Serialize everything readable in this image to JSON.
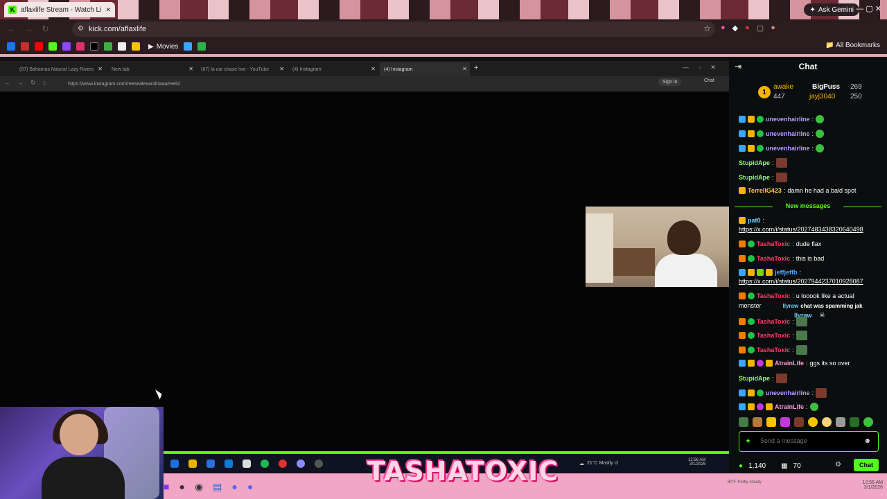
{
  "outer_browser": {
    "tab_title": "aflaxlife Stream - Watch Liv",
    "url": "kick.com/aflaxlife",
    "ask_gemini": "Ask Gemini",
    "bookmarks": {
      "movies": "Movies",
      "all": "All Bookmarks"
    }
  },
  "inner_browser": {
    "tabs": [
      {
        "label": "(67) Bahamas Natural Lazy Rivers"
      },
      {
        "label": "New tab"
      },
      {
        "label": "(67) la car chase live - YouTube"
      },
      {
        "label": "(4) Instagram"
      },
      {
        "label": "(4) Instagram"
      }
    ],
    "url": "https://www.instagram.com/reesealexandriaaa/reels/",
    "sign_in": "Sign in",
    "chat_btn": "Chat",
    "weather": "21°C  Mostly cl",
    "time": "12:56 AM",
    "date": "3/1/2026"
  },
  "overlay": {
    "name": "TASHATOXIC"
  },
  "outer_taskbar": {
    "weather": "80°F  Partly cloudy",
    "time": "12:56 AM",
    "date": "3/1/2026"
  },
  "chat": {
    "title": "Chat",
    "pinned": {
      "rank": "1",
      "user1": "awake",
      "user1_count": "447",
      "user2": "BigPuss",
      "user2_count": "269",
      "user3": "jayj3040",
      "user3_count": "250"
    },
    "messages": [
      {
        "user": "unevenhairline",
        "text": ""
      },
      {
        "user": "unevenhairline",
        "text": ""
      },
      {
        "user": "unevenhairline",
        "text": ""
      },
      {
        "user": "StupidApe",
        "text": ""
      },
      {
        "user": "StupidApe",
        "text": ""
      },
      {
        "user": "TerrellG423",
        "text": "damn he had a bald spot"
      },
      {
        "user": "pat0",
        "text": "https://x.com/i/status/2027483438320640498"
      },
      {
        "user": "TashaToxic",
        "text": "dude flax"
      },
      {
        "user": "TashaToxic",
        "text": "this is bad"
      },
      {
        "user": "jeffjeffb",
        "text": "https://x.com/i/status/2027944237010928087"
      },
      {
        "user": "TashaToxic",
        "text": "u looook like a actual",
        "text2": "monster",
        "overlay_user": "llyraw",
        "overlay_text": "chat was spamming jak"
      },
      {
        "user": "llyraw",
        "text": ""
      },
      {
        "user": "TashaToxic",
        "text": ""
      },
      {
        "user": "TashaToxic",
        "text": ""
      },
      {
        "user": "TashaToxic",
        "text": ""
      },
      {
        "user": "AtrainLife",
        "text": "ggs its so over"
      },
      {
        "user": "StupidApe",
        "text": ""
      },
      {
        "user": "unevenhairline",
        "text": ""
      },
      {
        "user": "AtrainLife",
        "text": ""
      }
    ],
    "new_messages": "New messages",
    "input_placeholder": "Send a message",
    "viewers": "1,140",
    "count2": "70",
    "send_label": "Chat",
    "colors": {
      "kick_green": "#53fc18",
      "tasha": "#ff3b6b",
      "uneven": "#b49cff",
      "stupid": "#9bff5a",
      "terrell": "#ffc83a",
      "jeff": "#4da6ff",
      "atrain": "#ff9ad6",
      "pat": "#6fd0ff"
    }
  }
}
